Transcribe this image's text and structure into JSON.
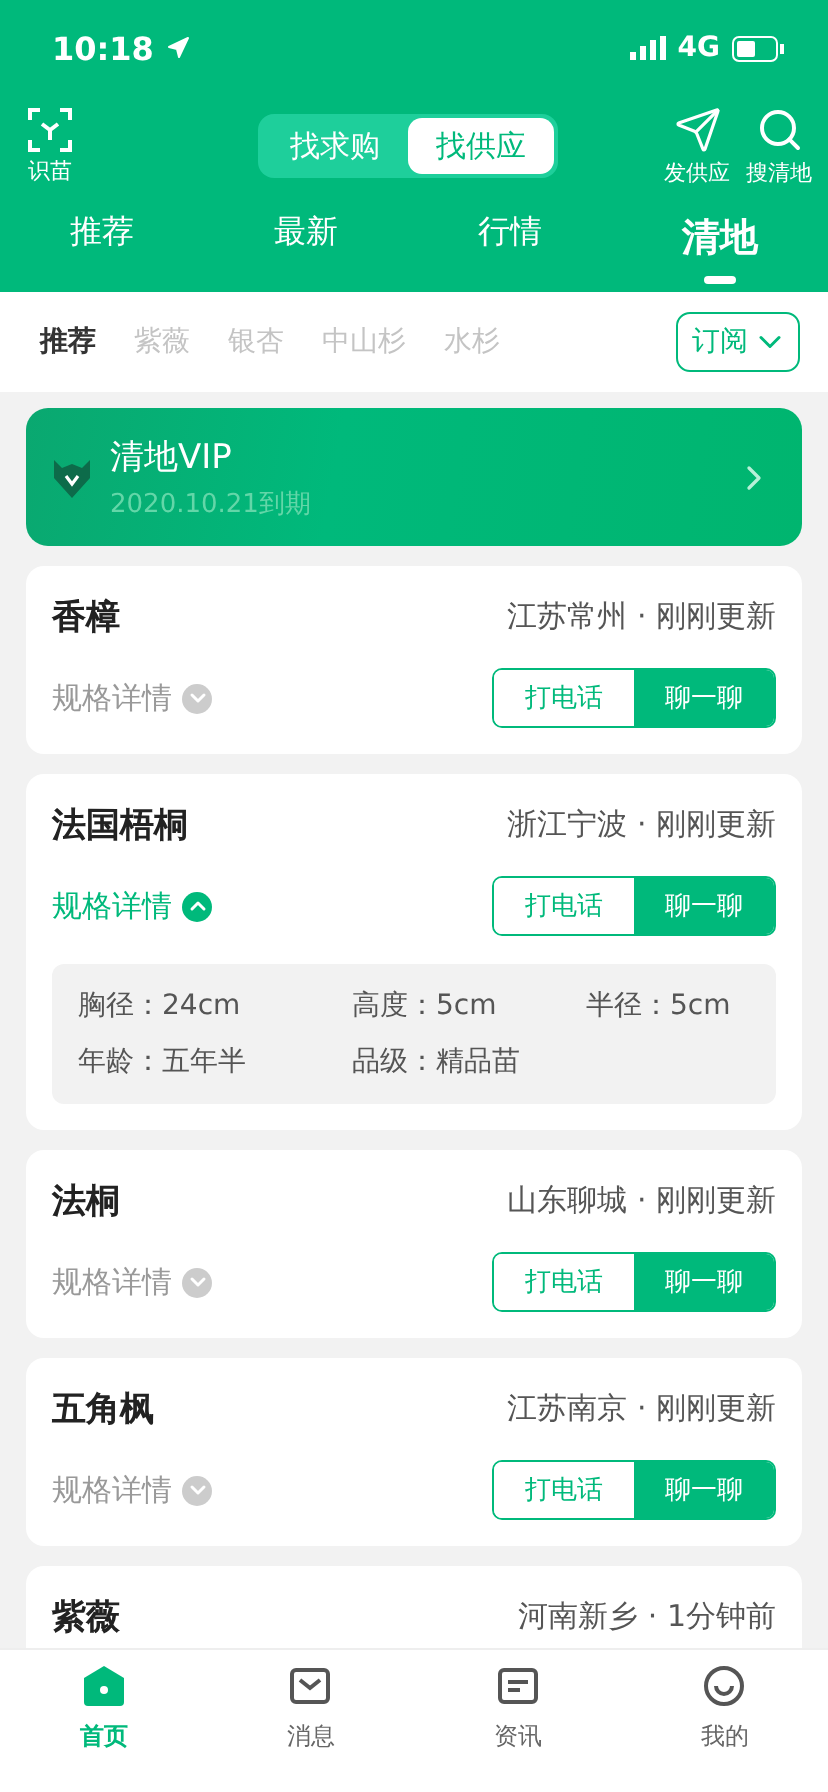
{
  "status_bar": {
    "time": "10:18",
    "network": "4G"
  },
  "header": {
    "scan_label": "识苗",
    "segments": [
      {
        "label": "找求购",
        "selected": false
      },
      {
        "label": "找供应",
        "selected": true
      }
    ],
    "actions": [
      {
        "kind": "send",
        "label": "发供应"
      },
      {
        "kind": "search",
        "label": "搜清地"
      }
    ]
  },
  "main_tabs": [
    {
      "label": "推荐",
      "selected": false
    },
    {
      "label": "最新",
      "selected": false
    },
    {
      "label": "行情",
      "selected": false
    },
    {
      "label": "清地",
      "selected": true
    }
  ],
  "sub_tabs": [
    {
      "label": "推荐",
      "selected": true
    },
    {
      "label": "紫薇",
      "selected": false
    },
    {
      "label": "银杏",
      "selected": false
    },
    {
      "label": "中山杉",
      "selected": false
    },
    {
      "label": "水杉",
      "selected": false
    }
  ],
  "subscribe": "订阅",
  "vip": {
    "title": "清地VIP",
    "expiry": "2020.10.21到期"
  },
  "listings": [
    {
      "name": "香樟",
      "meta": "江苏常州 · 刚刚更新",
      "specs_label": "规格详情",
      "expanded": false,
      "call": "打电话",
      "chat": "聊一聊"
    },
    {
      "name": "法国梧桐",
      "meta": "浙江宁波 · 刚刚更新",
      "specs_label": "规格详情",
      "expanded": true,
      "call": "打电话",
      "chat": "聊一聊",
      "specs": [
        "胸径：24cm",
        "高度：5cm",
        "半径：5cm",
        "年龄：五年半",
        "品级：精品苗"
      ]
    },
    {
      "name": "法桐",
      "meta": "山东聊城 · 刚刚更新",
      "specs_label": "规格详情",
      "expanded": false,
      "call": "打电话",
      "chat": "聊一聊"
    },
    {
      "name": "五角枫",
      "meta": "江苏南京 · 刚刚更新",
      "specs_label": "规格详情",
      "expanded": false,
      "call": "打电话",
      "chat": "聊一聊"
    },
    {
      "name": "紫薇",
      "meta": "河南新乡 · 1分钟前"
    }
  ],
  "bottom_nav": [
    {
      "kind": "home",
      "label": "首页",
      "selected": true
    },
    {
      "kind": "message",
      "label": "消息",
      "selected": false
    },
    {
      "kind": "news",
      "label": "资讯",
      "selected": false
    },
    {
      "kind": "me",
      "label": "我的",
      "selected": false
    }
  ]
}
